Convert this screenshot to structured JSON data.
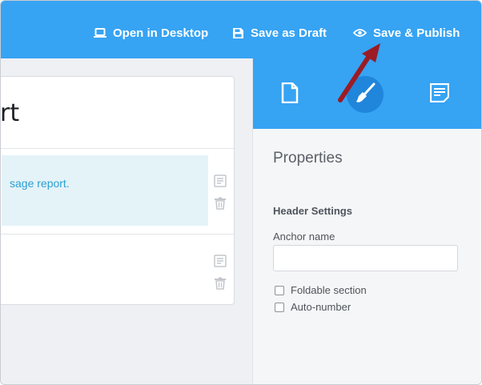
{
  "topbar": {
    "actions": [
      {
        "label": "Open in Desktop",
        "icon": "laptop-icon"
      },
      {
        "label": "Save as Draft",
        "icon": "save-icon"
      },
      {
        "label": "Save & Publish",
        "icon": "eye-icon"
      }
    ]
  },
  "document": {
    "heading_fragment": "rt",
    "blocks": [
      {
        "text": "sage report."
      },
      {
        "text": ""
      }
    ]
  },
  "panel": {
    "tabs": [
      {
        "name": "page",
        "icon": "document-icon"
      },
      {
        "name": "style",
        "icon": "paintbrush-icon",
        "active": true
      },
      {
        "name": "properties",
        "icon": "notes-icon"
      }
    ],
    "title": "Properties",
    "section_title": "Header Settings",
    "anchor_label": "Anchor name",
    "anchor_value": "",
    "checkboxes": [
      {
        "label": "Foldable section",
        "checked": false
      },
      {
        "label": "Auto-number",
        "checked": false
      }
    ]
  },
  "colors": {
    "accent": "#36a3f3",
    "accent_dark": "#1f86db",
    "annotation_arrow": "#9b1c24",
    "link_text": "#2b9fd3"
  }
}
